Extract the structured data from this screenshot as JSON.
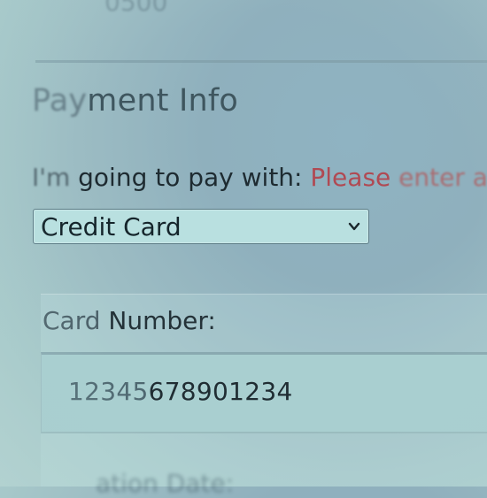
{
  "previous_field": {
    "value_fragment": "0500"
  },
  "payment_section": {
    "title_blurred": "Pay",
    "title_rest": "ment Info",
    "pay_with_label_faded": "I'm",
    "pay_with_label_rest": " going to pay with: ",
    "error_strong": "Please",
    "error_faded": " enter a",
    "method_select": {
      "selected": "Credit Card"
    }
  },
  "card_number": {
    "label_faded": "Card",
    "label_rest": " Number:",
    "value_faded": "12345",
    "value_rest": "678901234"
  },
  "next_field": {
    "label_fragment": "ation Date:"
  },
  "colors": {
    "accent_error": "#b04a53",
    "select_bg": "#b9e0e0",
    "input_bg": "#a9cfd0"
  }
}
